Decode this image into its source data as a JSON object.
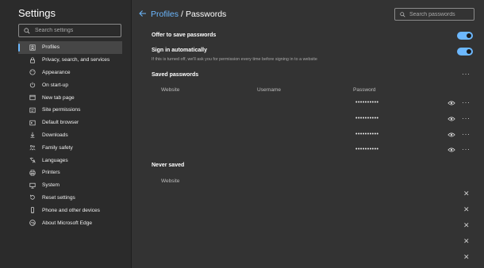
{
  "sidebar": {
    "title": "Settings",
    "search_placeholder": "Search settings",
    "items": [
      {
        "label": "Profiles",
        "icon": "profile-icon",
        "active": true
      },
      {
        "label": "Privacy, search, and services",
        "icon": "lock-icon"
      },
      {
        "label": "Appearance",
        "icon": "palette-icon"
      },
      {
        "label": "On start-up",
        "icon": "power-icon"
      },
      {
        "label": "New tab page",
        "icon": "newtab-icon"
      },
      {
        "label": "Site permissions",
        "icon": "site-permissions-icon"
      },
      {
        "label": "Default browser",
        "icon": "browser-icon"
      },
      {
        "label": "Downloads",
        "icon": "download-icon"
      },
      {
        "label": "Family safety",
        "icon": "family-icon"
      },
      {
        "label": "Languages",
        "icon": "languages-icon"
      },
      {
        "label": "Printers",
        "icon": "printer-icon"
      },
      {
        "label": "System",
        "icon": "system-icon"
      },
      {
        "label": "Reset settings",
        "icon": "reset-icon"
      },
      {
        "label": "Phone and other devices",
        "icon": "phone-icon"
      },
      {
        "label": "About Microsoft Edge",
        "icon": "edge-icon"
      }
    ]
  },
  "header": {
    "breadcrumb_parent": "Profiles",
    "breadcrumb_sep": "/",
    "breadcrumb_current": "Passwords",
    "search_placeholder": "Search passwords"
  },
  "settings": {
    "offer_save": {
      "label": "Offer to save passwords",
      "enabled": true
    },
    "sign_in_auto": {
      "label": "Sign in automatically",
      "description": "If this is turned off, we'll ask you for permission every time before signing in to a website",
      "enabled": true
    }
  },
  "saved_passwords": {
    "title": "Saved passwords",
    "columns": [
      "Website",
      "Username",
      "Password"
    ],
    "rows": [
      {
        "website": "",
        "username": "",
        "password": "••••••••••"
      },
      {
        "website": "",
        "username": "",
        "password": "••••••••••"
      },
      {
        "website": "",
        "username": "",
        "password": "••••••••••"
      },
      {
        "website": "",
        "username": "",
        "password": "••••••••••"
      }
    ]
  },
  "never_saved": {
    "title": "Never saved",
    "column": "Website",
    "rows": [
      "",
      "",
      "",
      "",
      ""
    ]
  },
  "colors": {
    "accent": "#6cb8ff",
    "sidebar_bg": "#2b2b2b",
    "main_bg": "#333333"
  }
}
